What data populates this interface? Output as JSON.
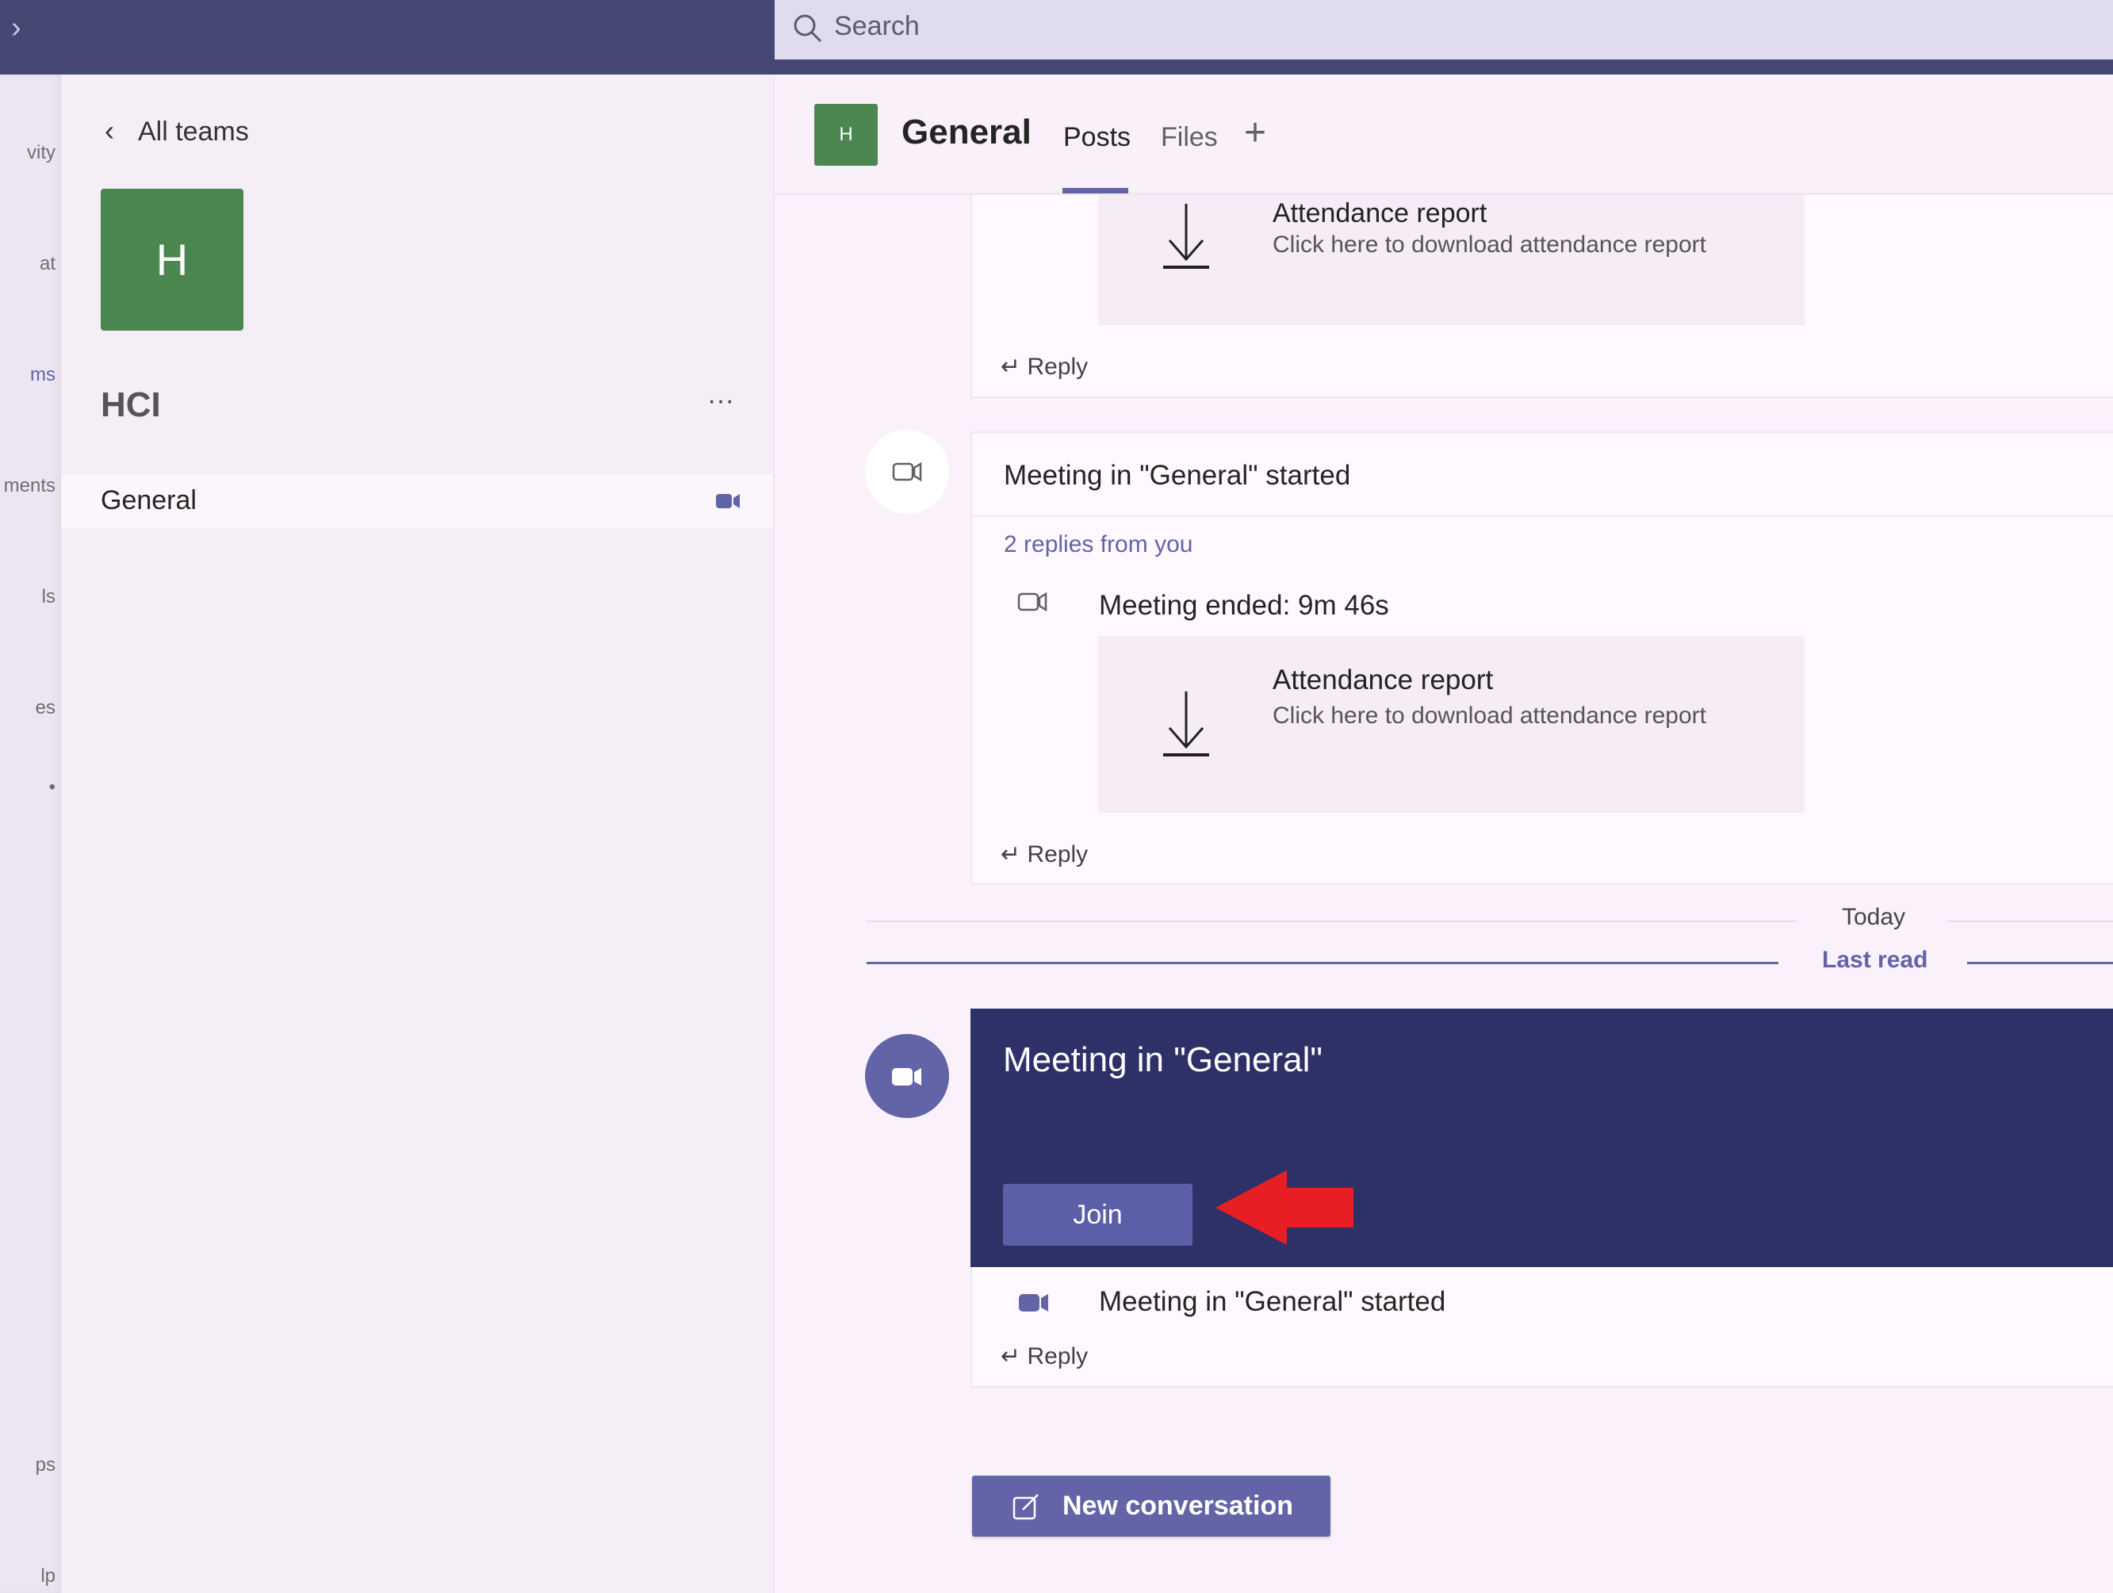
{
  "topbar": {
    "search_placeholder": "Search"
  },
  "rail": {
    "items": [
      "vity",
      "at",
      "ms",
      "ments",
      "ls",
      "es",
      "•",
      "ps",
      "lp"
    ]
  },
  "panel": {
    "back_label": "All teams",
    "team_initial": "H",
    "team_name": "HCI",
    "more": "···",
    "channels": [
      {
        "name": "General"
      }
    ]
  },
  "header": {
    "avatar_initial": "H",
    "channel": "General",
    "tabs": [
      "Posts",
      "Files"
    ],
    "add_tab": "+"
  },
  "feed": {
    "card1": {
      "attachment_title": "Attendance report",
      "attachment_sub": "Click here to download attendance report",
      "reply": "Reply"
    },
    "card2": {
      "title": "Meeting in \"General\" started",
      "replies": "2 replies from you",
      "ended": "Meeting ended: 9m 46s",
      "attachment_title": "Attendance report",
      "attachment_sub": "Click here to download attendance report",
      "reply": "Reply"
    },
    "divider_today": "Today",
    "divider_last_read": "Last read",
    "card3": {
      "title": "Meeting in \"General\"",
      "join": "Join",
      "started": "Meeting in \"General\" started",
      "reply": "Reply"
    }
  },
  "new_conversation": "New conversation",
  "colors": {
    "brand": "#6264a7",
    "topbar": "#464775",
    "meeting": "#2e3168",
    "team_green": "#4b8550",
    "annotation": "#e81e25"
  }
}
